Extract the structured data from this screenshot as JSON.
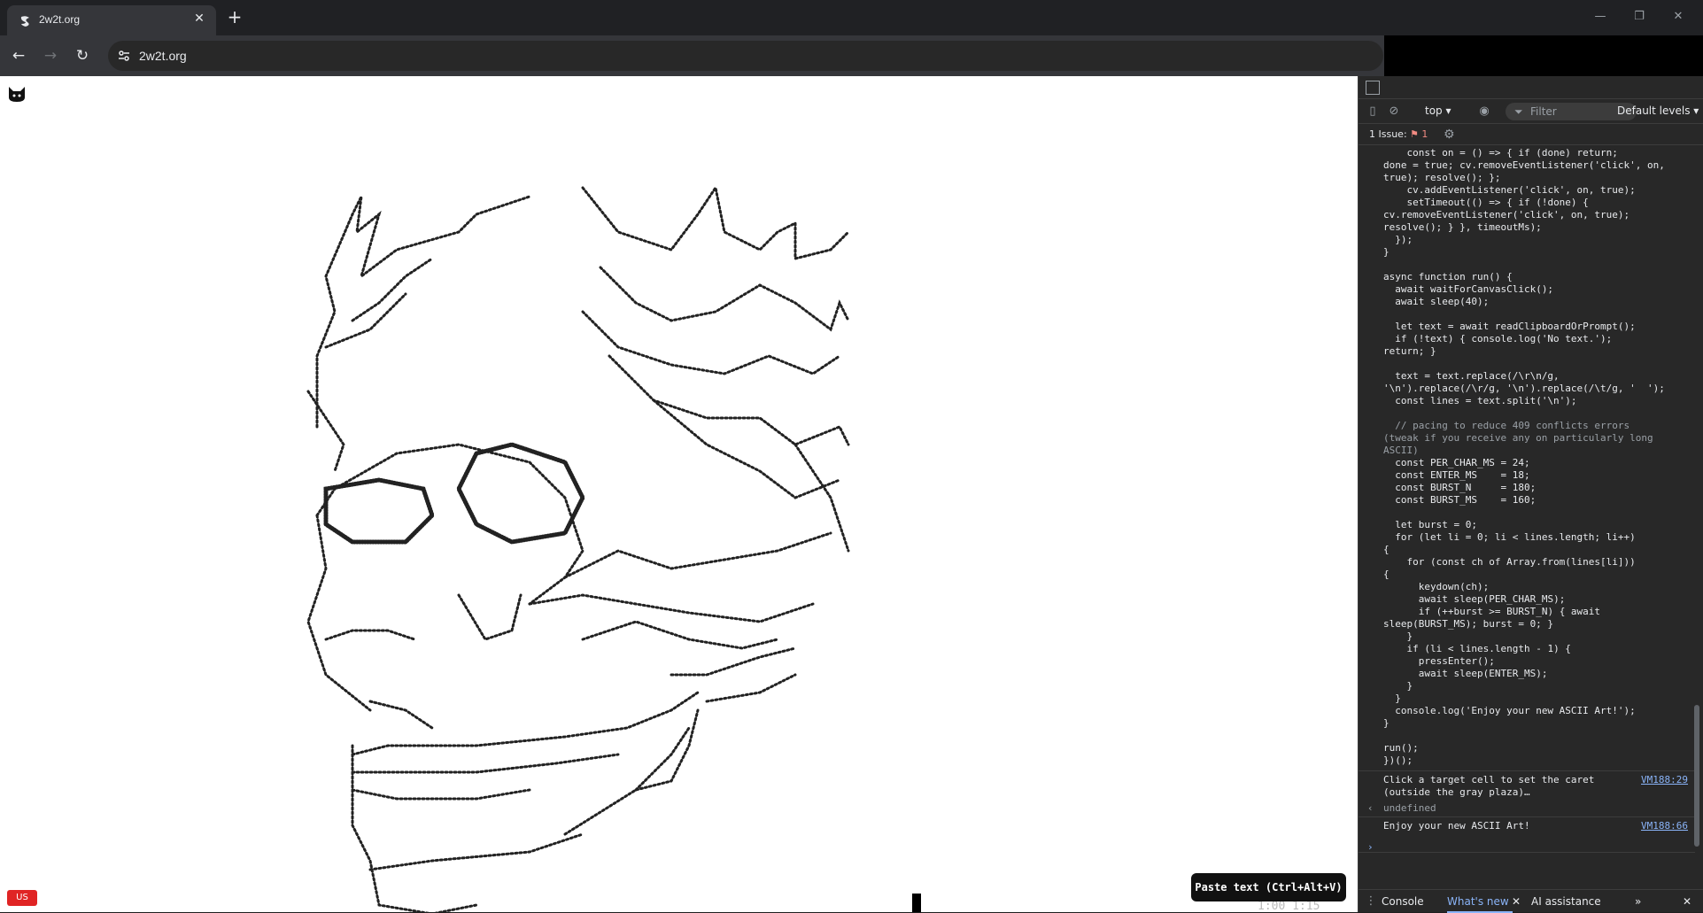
{
  "browser": {
    "tab_title": "2w2t.org",
    "tab_close": "✕",
    "new_tab": "+",
    "url": "2w2t.org",
    "back": "←",
    "forward": "→",
    "reload": "↻",
    "minimize": "—",
    "restore": "❐",
    "close": "✕"
  },
  "page": {
    "lang_badge": "US",
    "paste_button": "Paste text (Ctrl+Alt+V)",
    "hud_text": "1:00 1:15"
  },
  "devtools": {
    "context": "top ▾",
    "filter_placeholder": "Filter",
    "levels": "Default levels ▾",
    "issues_label": "1 Issue:",
    "issues_count": "1",
    "code_lines": [
      "    const on = () => { if (done) return;",
      "done = true; cv.removeEventListener('click', on,",
      "true); resolve(); };",
      "    cv.addEventListener('click', on, true);",
      "    setTimeout(() => { if (!done) {",
      "cv.removeEventListener('click', on, true);",
      "resolve(); } }, timeoutMs);",
      "  });",
      "}",
      "",
      "async function run() {",
      "  await waitForCanvasClick();",
      "  await sleep(40);",
      "",
      "  let text = await readClipboardOrPrompt();",
      "  if (!text) { console.log('No text.');",
      "return; }",
      "",
      "  text = text.replace(/\\r\\n/g,",
      "'\\n').replace(/\\r/g, '\\n').replace(/\\t/g, '  ');",
      "  const lines = text.split('\\n');",
      "",
      "  // pacing to reduce 409 conflicts errors",
      "(tweak if you receive any on particularly long",
      "ASCII)",
      "  const PER_CHAR_MS = 24;",
      "  const ENTER_MS    = 18;",
      "  const BURST_N     = 180;",
      "  const BURST_MS    = 160;",
      "",
      "  let burst = 0;",
      "  for (let li = 0; li < lines.length; li++)",
      "{",
      "    for (const ch of Array.from(lines[li]))",
      "{",
      "      keydown(ch);",
      "      await sleep(PER_CHAR_MS);",
      "      if (++burst >= BURST_N) { await",
      "sleep(BURST_MS); burst = 0; }",
      "    }",
      "    if (li < lines.length - 1) {",
      "      pressEnter();",
      "      await sleep(ENTER_MS);",
      "    }",
      "  }",
      "  console.log('Enjoy your new ASCII Art!');",
      "}",
      "",
      "run();",
      "})();"
    ],
    "log1_text": "Click a target cell to set the caret\n(outside the gray plaza)…",
    "log1_source": "VM188:29",
    "return_value": "undefined",
    "log2_text": "Enjoy your new ASCII Art!",
    "log2_source": "VM188:66",
    "drawer_tabs": [
      "Console",
      "What's new",
      "AI assistance"
    ],
    "drawer_more": "»",
    "drawer_close": "✕"
  }
}
